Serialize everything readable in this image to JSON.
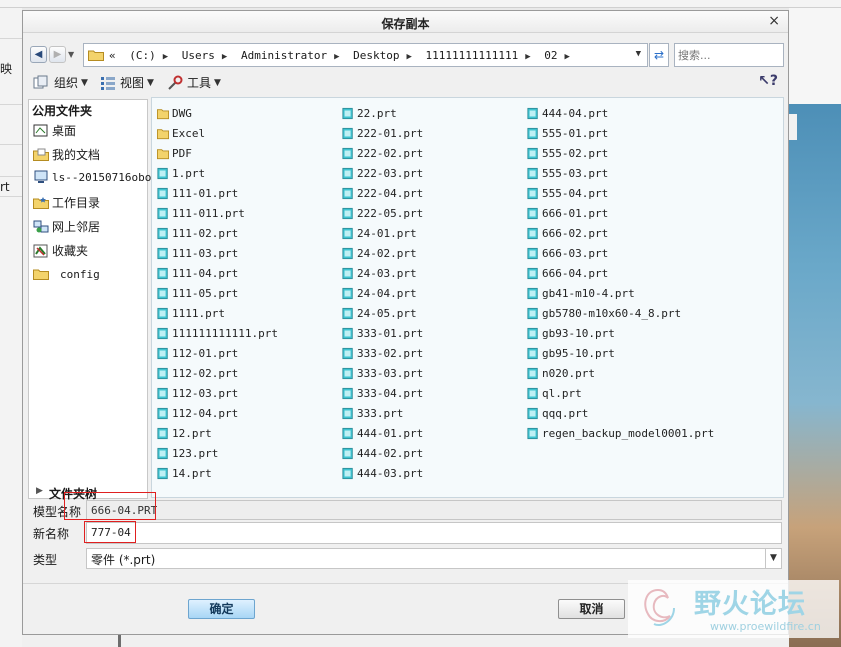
{
  "background": {
    "left_fragments": [
      "映",
      "rt"
    ]
  },
  "dialog": {
    "title": "保存副本",
    "close": "×"
  },
  "address": {
    "lead": "«",
    "crumbs": [
      "(C:)",
      "Users",
      "Administrator",
      "Desktop",
      "11111111111111",
      "02"
    ],
    "search_placeholder": "搜索..."
  },
  "toolbar": {
    "organize": "组织",
    "view": "视图",
    "tools": "工具"
  },
  "nav": {
    "header": "公用文件夹",
    "items": [
      {
        "label": "桌面",
        "icon": "desktop-icon"
      },
      {
        "label": "我的文档",
        "icon": "documents-icon"
      },
      {
        "label": "ls--20150716obo",
        "icon": "computer-icon"
      },
      {
        "label": "工作目录",
        "icon": "workdir-icon"
      },
      {
        "label": "网上邻居",
        "icon": "network-icon"
      },
      {
        "label": "收藏夹",
        "icon": "favorites-icon"
      },
      {
        "label": "config",
        "icon": "folder-icon"
      }
    ],
    "tree_label": "文件夹树"
  },
  "files": {
    "columns": [
      [
        "DWG",
        "Excel",
        "PDF",
        "1.prt",
        "111-01.prt",
        "111-011.prt",
        "111-02.prt",
        "111-03.prt",
        "111-04.prt",
        "111-05.prt",
        "1111.prt",
        "111111111111.prt",
        "112-01.prt",
        "112-02.prt",
        "112-03.prt",
        "112-04.prt",
        "12.prt",
        "123.prt",
        "14.prt"
      ],
      [
        "22.prt",
        "222-01.prt",
        "222-02.prt",
        "222-03.prt",
        "222-04.prt",
        "222-05.prt",
        "24-01.prt",
        "24-02.prt",
        "24-03.prt",
        "24-04.prt",
        "24-05.prt",
        "333-01.prt",
        "333-02.prt",
        "333-03.prt",
        "333-04.prt",
        "333.prt",
        "444-01.prt",
        "444-02.prt",
        "444-03.prt"
      ],
      [
        "444-04.prt",
        "555-01.prt",
        "555-02.prt",
        "555-03.prt",
        "555-04.prt",
        "666-01.prt",
        "666-02.prt",
        "666-03.prt",
        "666-04.prt",
        "gb41-m10-4.prt",
        "gb5780-m10x60-4_8.prt",
        "gb93-10.prt",
        "gb95-10.prt",
        "n020.prt",
        "ql.prt",
        "qqq.prt",
        "regen_backup_model0001.prt"
      ]
    ],
    "folders": [
      "DWG",
      "Excel",
      "PDF"
    ]
  },
  "form": {
    "model_label": "模型名称",
    "model_value": "666-04.PRT",
    "new_label": "新名称",
    "new_value": "777-04",
    "type_label": "类型",
    "type_value": "零件 (*.prt)"
  },
  "buttons": {
    "ok": "确定",
    "cancel": "取消"
  },
  "watermark": {
    "text": "野火论坛",
    "url": "www.proewildfire.cn"
  },
  "colors": {
    "red_highlight": "#e02020",
    "part_icon": "#3ec3d0",
    "folder_icon": "#f3d36b",
    "list_bg": "#f5fafc"
  }
}
